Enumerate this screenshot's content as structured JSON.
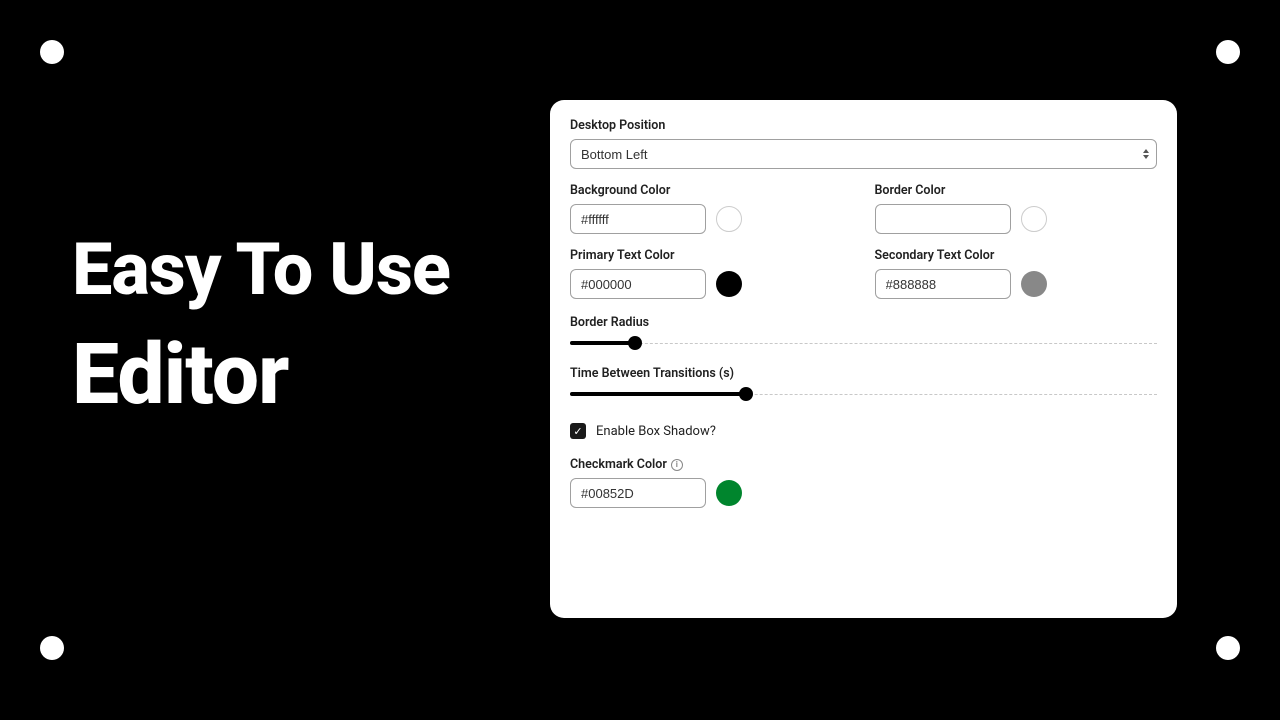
{
  "headline": {
    "line1": "Easy To Use",
    "line2": "Editor"
  },
  "panel": {
    "desktopPosition": {
      "label": "Desktop Position",
      "value": "Bottom Left"
    },
    "backgroundColor": {
      "label": "Background Color",
      "value": "#ffffff",
      "swatch": "#ffffff"
    },
    "borderColor": {
      "label": "Border Color",
      "value": "",
      "swatch": "#ffffff"
    },
    "primaryTextColor": {
      "label": "Primary Text Color",
      "value": "#000000",
      "swatch": "#000000"
    },
    "secondaryTextColor": {
      "label": "Secondary Text Color",
      "value": "#888888",
      "swatch": "#888888"
    },
    "borderRadius": {
      "label": "Border Radius",
      "percent": 11
    },
    "timeBetween": {
      "label": "Time Between Transitions (s)",
      "percent": 30
    },
    "enableBoxShadow": {
      "label": "Enable Box Shadow?",
      "checked": true
    },
    "checkmarkColor": {
      "label": "Checkmark Color",
      "value": "#00852D",
      "swatch": "#00852D"
    }
  }
}
